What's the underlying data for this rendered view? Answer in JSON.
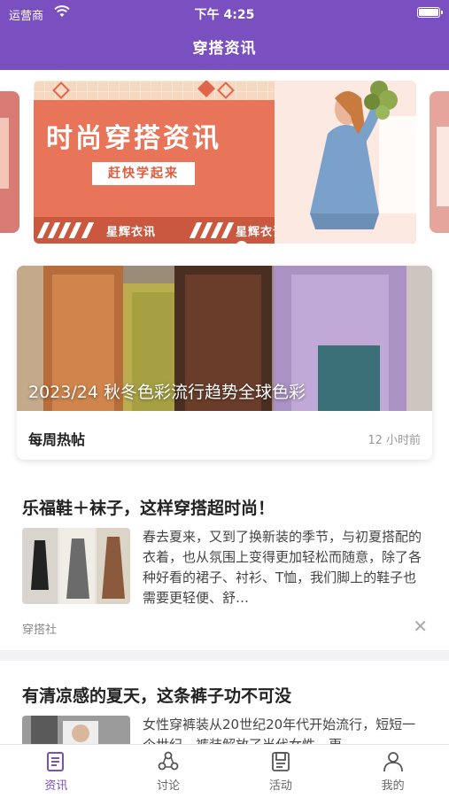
{
  "status_bar": {
    "carrier": "运营商",
    "time": "下午 4:25"
  },
  "header": {
    "title": "穿搭资讯"
  },
  "banner": {
    "headline": "时尚穿搭资讯",
    "subtitle": "赶快学起来",
    "tag": "星辉衣讯",
    "slide_count": 2,
    "active_slide": 1
  },
  "featured": {
    "caption": "2023/24 秋冬色彩流行趋势全球色彩",
    "label": "每周热帖",
    "time": "12 小时前"
  },
  "articles": [
    {
      "title": "乐福鞋＋袜子，这样穿搭超时尚！",
      "excerpt": "春去夏来，又到了换新装的季节，与初夏搭配的衣着，也从氛围上变得更加轻松而随意，除了各种好看的裙子、衬衫、T恤，我们脚上的鞋子也需要更轻便、舒…",
      "source": "穿搭社"
    },
    {
      "title": "有清凉感的夏天，这条裤子功不可没",
      "excerpt": "女性穿裤装从20世纪20年代开始流行，短短一个世纪，裤装解放了当代女性，更"
    }
  ],
  "tabs": [
    {
      "label": "资讯",
      "icon": "news-icon",
      "active": true
    },
    {
      "label": "讨论",
      "icon": "discussion-icon",
      "active": false
    },
    {
      "label": "活动",
      "icon": "activity-icon",
      "active": false
    },
    {
      "label": "我的",
      "icon": "profile-icon",
      "active": false
    }
  ],
  "colors": {
    "accent": "#7a4fbf",
    "banner_orange": "#e8755a"
  }
}
